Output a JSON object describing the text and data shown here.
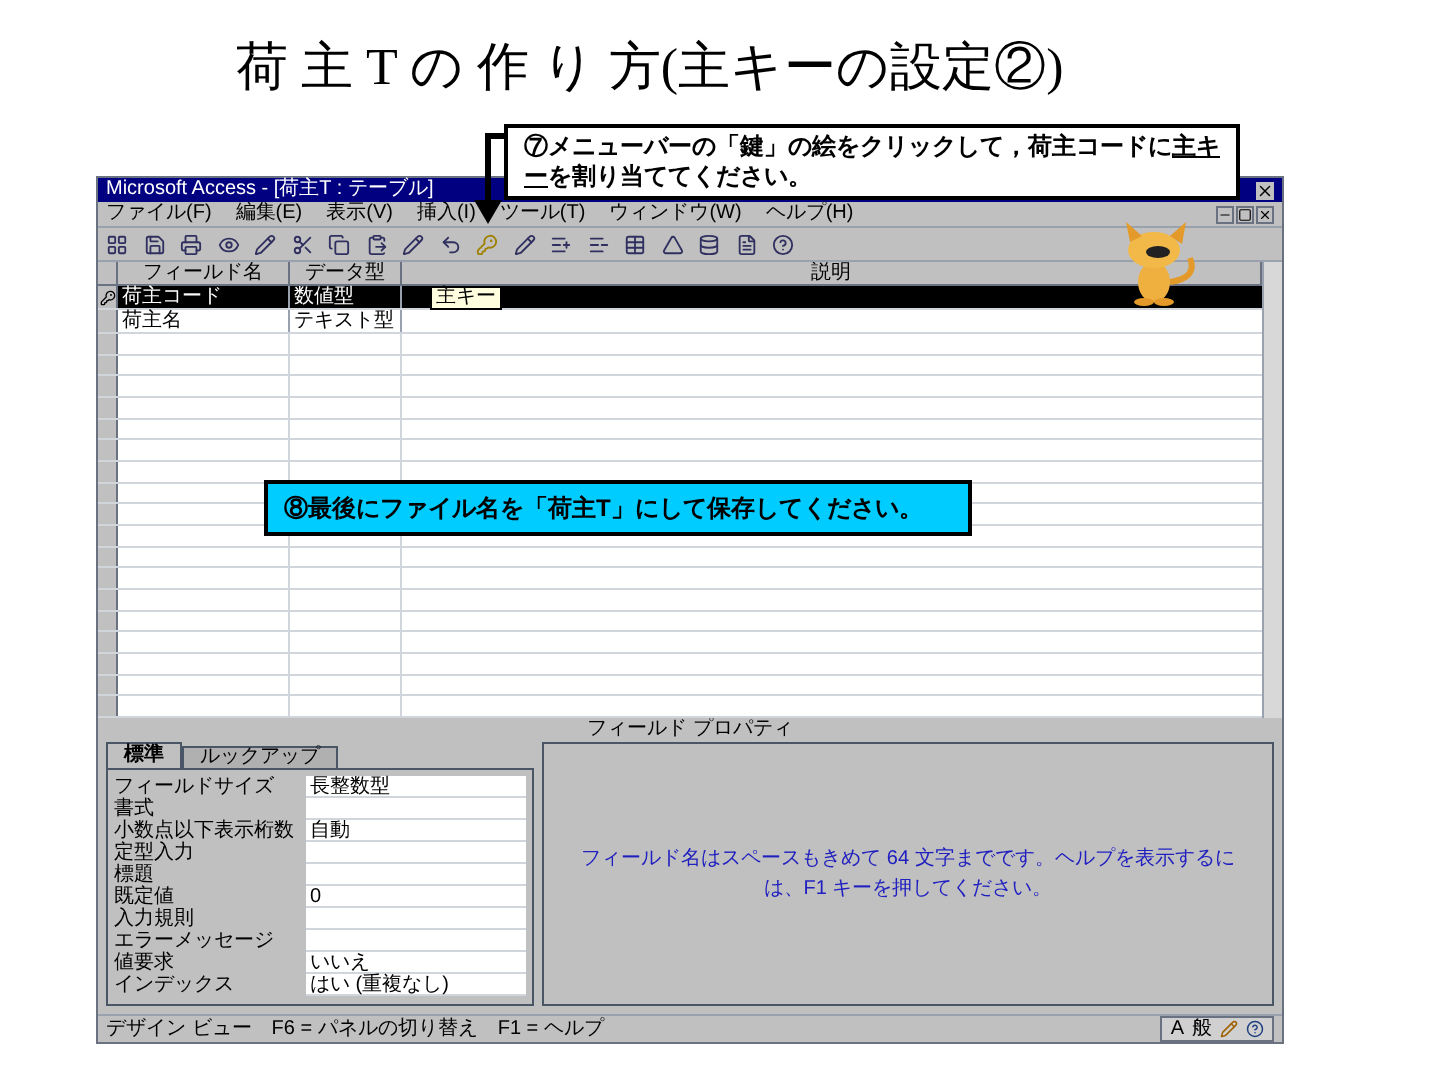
{
  "slide_title": "荷 主 T の 作 り 方(主キーの設定②)",
  "window": {
    "title": "Microsoft Access - [荷主T : テーブル]"
  },
  "menu": [
    "ファイル(F)",
    "編集(E)",
    "表示(V)",
    "挿入(I)",
    "ツール(T)",
    "ウィンドウ(W)",
    "ヘルプ(H)"
  ],
  "table": {
    "columns": [
      "フィールド名",
      "データ型",
      "説明"
    ],
    "rows": [
      {
        "field": "荷主コード",
        "type": "数値型",
        "selected": true,
        "primary_key": true
      },
      {
        "field": "荷主名",
        "type": "テキスト型",
        "selected": false,
        "primary_key": false
      }
    ]
  },
  "tooltip": "主キー",
  "properties_title": "フィールド プロパティ",
  "property_tabs": [
    {
      "label": "標準",
      "selected": true
    },
    {
      "label": "ルックアップ",
      "selected": false
    }
  ],
  "properties": [
    {
      "label": "フィールドサイズ",
      "value": "長整数型"
    },
    {
      "label": "書式"
    },
    {
      "label": "小数点以下表示桁数",
      "value": "自動"
    },
    {
      "label": "定型入力"
    },
    {
      "label": "標題"
    },
    {
      "label": "既定値",
      "value": "0"
    },
    {
      "label": "入力規則"
    },
    {
      "label": "エラーメッセージ"
    },
    {
      "label": "値要求",
      "value": "いいえ"
    },
    {
      "label": "インデックス",
      "value": "はい (重複なし)"
    }
  ],
  "help_text": "フィールド名はスペースもきめて 64 文字までです。ヘルプを表示するには、F1 キーを押してください。",
  "status_bar": "デザイン ビュー　F6 = パネルの切り替え　F1 = ヘルプ",
  "ime": [
    "A",
    "般"
  ],
  "callout_top": {
    "before": "⑦メニューバーの「鍵」の絵をクリックして，荷主コードに",
    "underlined": "主キー",
    "after": "を割り当ててください。"
  },
  "callout_bottom": "⑧最後にファイル名を「荷主T」にして保存してください。"
}
